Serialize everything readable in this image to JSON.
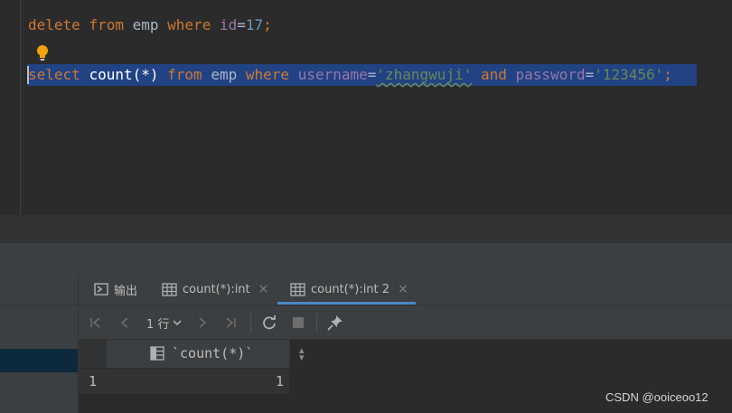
{
  "editor": {
    "line1": {
      "kw_delete": "delete",
      "kw_from": "from",
      "table": "emp",
      "kw_where": "where",
      "col": "id",
      "op": "=",
      "num": "17",
      "semi": ";"
    },
    "line2": {
      "kw_select": "select",
      "fn": "count(*)",
      "kw_from": "from",
      "table": "emp",
      "kw_where": "where",
      "col_username": "username",
      "eq1": "=",
      "str_user": "'zhangwuji'",
      "kw_and": "and",
      "col_password": "password",
      "eq2": "=",
      "str_pass": "'123456'",
      "semi": ";"
    }
  },
  "panel": {
    "tabs": [
      {
        "label": "输出",
        "icon": "console-icon",
        "closable": false
      },
      {
        "label": "count(*):int",
        "icon": "table-icon",
        "closable": true
      },
      {
        "label": "count(*):int 2",
        "icon": "table-icon",
        "closable": true,
        "active": true
      }
    ],
    "close_glyph": "×",
    "toolbar": {
      "rows_label": "1 行",
      "first_glyph": "|<",
      "prev_glyph": "<",
      "next_glyph": ">",
      "last_glyph": ">|"
    },
    "grid": {
      "columns": [
        "`count(*)`"
      ],
      "rows": [
        {
          "row_number": "1",
          "values": [
            "1"
          ]
        }
      ]
    }
  },
  "watermark": "CSDN @ooiceoo12",
  "colors": {
    "keyword": "#cc7832",
    "string": "#6a8759",
    "number": "#6897bb",
    "field": "#9876aa",
    "selection": "#214283",
    "accent_tab": "#4a88c7"
  }
}
